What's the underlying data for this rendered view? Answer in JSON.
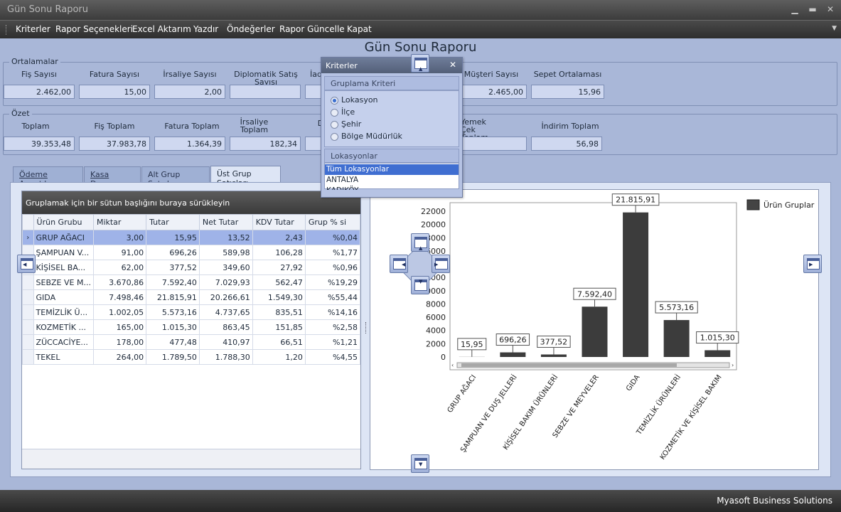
{
  "window": {
    "title": "Gün Sonu Raporu",
    "controls": [
      "minimize-icon",
      "maximize-icon",
      "close-icon"
    ]
  },
  "menu": [
    "Kriterler",
    "Rapor Seçenekleri",
    "Excel Aktarım",
    "Yazdır",
    "Öndeğerler",
    "Rapor Güncelle",
    "Kapat"
  ],
  "page_title": "Gün Sonu Raporu",
  "ortalamalar": {
    "title": "Ortalamalar",
    "fields": [
      {
        "label": "Fiş Sayısı",
        "value": "2.462,00"
      },
      {
        "label": "Fatura Sayısı",
        "value": "15,00"
      },
      {
        "label": "İrsaliye Sayısı",
        "value": "2,00"
      },
      {
        "label": "Diplomatik Satış Sayısı",
        "value": ""
      },
      {
        "label": "İad",
        "value": ""
      },
      {
        "label": "Müşteri Sayısı",
        "value": "2.465,00"
      },
      {
        "label": "Sepet Ortalaması",
        "value": "15,96"
      }
    ]
  },
  "ozet": {
    "title": "Özet",
    "fields": [
      {
        "label": "Toplam",
        "value": "39.353,48"
      },
      {
        "label": "Fiş Toplam",
        "value": "37.983,78"
      },
      {
        "label": "Fatura Toplam",
        "value": "1.364,39"
      },
      {
        "label": "İrsaliye Toplam",
        "value": "182,34"
      },
      {
        "label": "D",
        "value": ""
      },
      {
        "label": "Yemek Çek Toplam",
        "value": ""
      },
      {
        "label": "İndirim Toplam",
        "value": "56,98"
      }
    ]
  },
  "tabs": [
    "Ödeme Ayrıntıları",
    "Kasa Durumu",
    "Alt Grup Satışları",
    "Üst Grup Satışları"
  ],
  "active_tab": "Üst Grup Satışları",
  "grid": {
    "group_hint": "Gruplamak için bir sütun başlığını buraya sürükleyin",
    "columns": [
      "Ürün Grubu",
      "Miktar",
      "Tutar",
      "Net Tutar",
      "KDV Tutar",
      "Grup % si"
    ],
    "rows": [
      [
        "GRUP AĞACI",
        "3,00",
        "15,95",
        "13,52",
        "2,43",
        "%0,04"
      ],
      [
        "ŞAMPUAN V...",
        "91,00",
        "696,26",
        "589,98",
        "106,28",
        "%1,77"
      ],
      [
        "KİŞİSEL BA...",
        "62,00",
        "377,52",
        "349,60",
        "27,92",
        "%0,96"
      ],
      [
        "SEBZE VE M...",
        "3.670,86",
        "7.592,40",
        "7.029,93",
        "562,47",
        "%19,29"
      ],
      [
        "GIDA",
        "7.498,46",
        "21.815,91",
        "20.266,61",
        "1.549,30",
        "%55,44"
      ],
      [
        "TEMİZLİK Ü...",
        "1.002,05",
        "5.573,16",
        "4.737,65",
        "835,51",
        "%14,16"
      ],
      [
        "KOZMETİK ...",
        "165,00",
        "1.015,30",
        "863,45",
        "151,85",
        "%2,58"
      ],
      [
        "ZÜCCACİYE...",
        "178,00",
        "477,48",
        "410,97",
        "66,51",
        "%1,21"
      ],
      [
        "TEKEL",
        "264,00",
        "1.789,50",
        "1.788,30",
        "1,20",
        "%4,55"
      ]
    ]
  },
  "chart_data": {
    "type": "bar",
    "categories": [
      "GRUP AĞACI",
      "ŞAMPUAN VE DUŞ JELLERİ",
      "KİŞİSEL BAKIM ÜRÜNLERİ",
      "SEBZE VE MEYVELER",
      "GIDA",
      "TEMİZLİK ÜRÜNLERİ",
      "KOZMETİK VE KİŞİSEL BAKIM"
    ],
    "values": [
      15.95,
      696.26,
      377.52,
      7592.4,
      21815.91,
      5573.16,
      1015.3
    ],
    "value_labels": [
      "15,95",
      "696,26",
      "377,52",
      "7.592,40",
      "21.815,91",
      "5.573,16",
      "1.015,30"
    ],
    "series": [
      {
        "name": "Ürün Gruplar"
      }
    ],
    "yticks": [
      "0",
      "2000",
      "4000",
      "6000",
      "8000",
      "10000",
      "12000",
      "14000",
      "16000",
      "18000",
      "20000",
      "22000"
    ],
    "ylim": [
      0,
      22000
    ],
    "legend": "top-right",
    "bar_color": "#3c3c3c"
  },
  "kriterler": {
    "title": "Kriterler",
    "grouping_title": "Gruplama Kriteri",
    "options": [
      "Lokasyon",
      "İlçe",
      "Şehir",
      "Bölge Müdürlük"
    ],
    "selected": "Lokasyon",
    "locations_title": "Lokasyonlar",
    "locations": [
      "Tüm Lokasyonlar",
      "ANTALYA",
      "KADIKÖY"
    ]
  },
  "status": "Myasoft Business Solutions"
}
